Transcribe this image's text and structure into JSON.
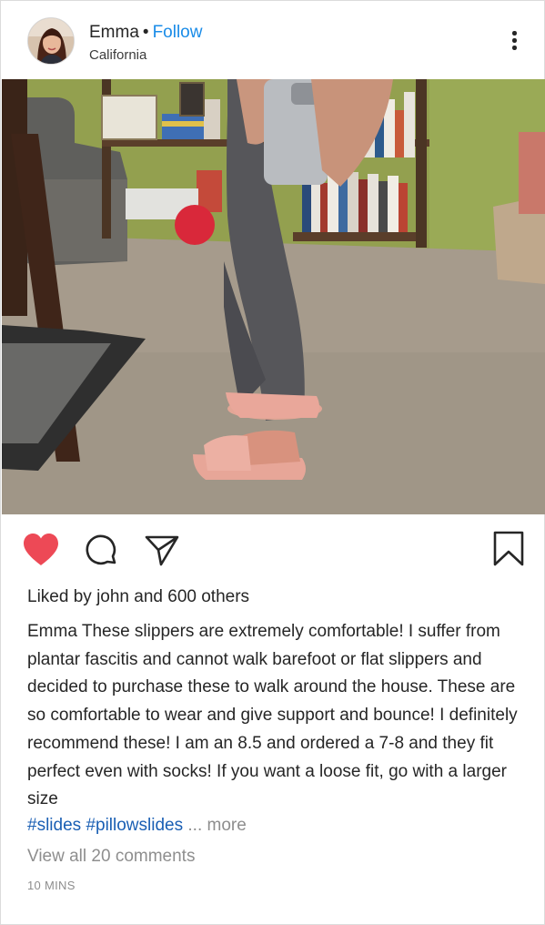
{
  "header": {
    "username": "Emma",
    "separator": "•",
    "follow_label": "Follow",
    "location": "California",
    "avatar_icon": "profile-photo",
    "more_icon": "more-options-icon"
  },
  "photo": {
    "description_icon": "post-photo"
  },
  "actions": {
    "like_icon": "heart-filled-icon",
    "comment_icon": "comment-icon",
    "share_icon": "share-icon",
    "save_icon": "bookmark-icon",
    "like_color": "#ed4956"
  },
  "likes": {
    "prefix": "Liked by",
    "user": "john",
    "conjunction": "and",
    "others": "600 others"
  },
  "caption": {
    "username": "Emma",
    "text": "These slippers are extremely comfortable! I suffer from plantar fascitis and cannot walk barefoot or flat slippers and decided to purchase these to walk around the house. These are so comfortable to wear and give support and bounce! I definitely recommend these! I am an 8.5 and ordered a 7-8 and they fit perfect even with socks! If you want a loose fit, go with a larger size",
    "hashtags": [
      "#slides",
      "#pillowslides"
    ],
    "more_label": "... more"
  },
  "comments": {
    "view_all_label": "View all 20 comments"
  },
  "timestamp": "10 MINS",
  "colors": {
    "follow": "#1a8ce8",
    "hashtag": "#1a5fb4",
    "muted": "#8e8e8e",
    "text": "#262626"
  }
}
